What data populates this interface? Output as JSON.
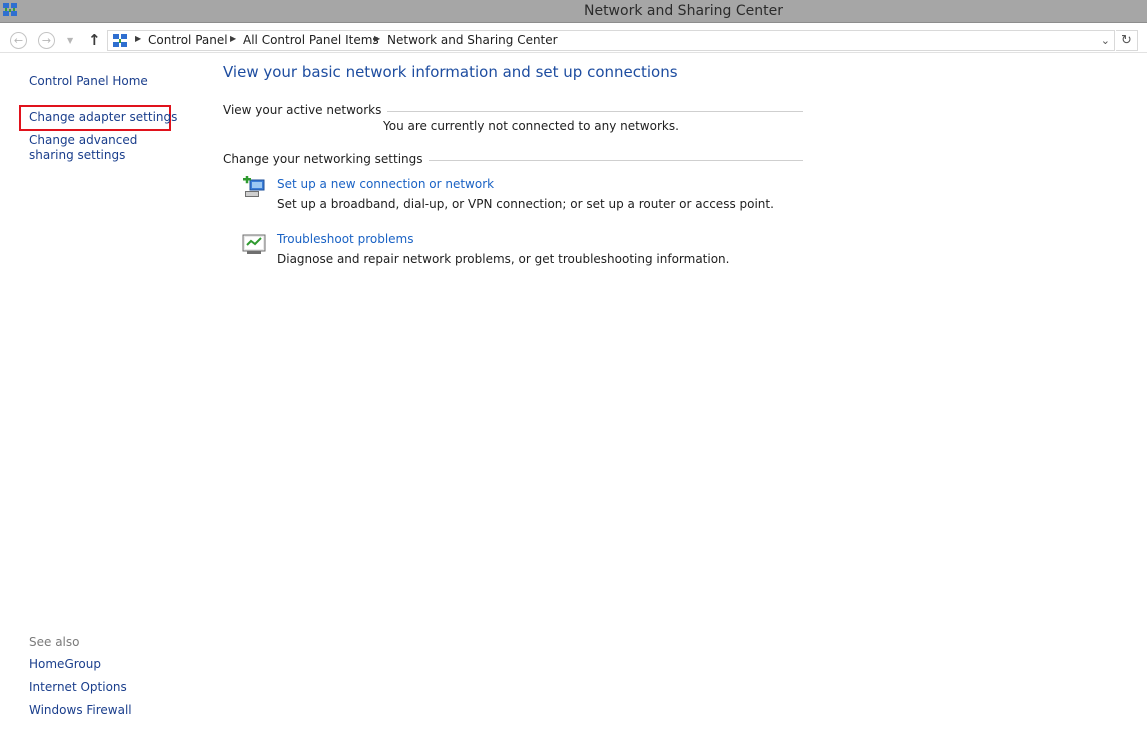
{
  "window": {
    "title": "Network and Sharing Center"
  },
  "address_bar": {
    "back_glyph": "←",
    "forward_glyph": "→",
    "up_glyph": "↑",
    "breadcrumbs": [
      "Control Panel",
      "All Control Panel Items",
      "Network and Sharing Center"
    ]
  },
  "sidebar": {
    "home": "Control Panel Home",
    "links": [
      "Change adapter settings",
      "Change advanced sharing settings"
    ],
    "see_also_title": "See also",
    "see_also": [
      "HomeGroup",
      "Internet Options",
      "Windows Firewall"
    ]
  },
  "main": {
    "heading": "View your basic network information and set up connections",
    "active_networks_label": "View your active networks",
    "not_connected": "You are currently not connected to any networks.",
    "settings_label": "Change your networking settings",
    "tasks": [
      {
        "icon": "new-connection-icon",
        "link": "Set up a new connection or network",
        "desc": "Set up a broadband, dial-up, or VPN connection; or set up a router or access point."
      },
      {
        "icon": "troubleshoot-icon",
        "link": "Troubleshoot problems",
        "desc": "Diagnose and repair network problems, or get troubleshooting information."
      }
    ]
  },
  "colors": {
    "link": "#1a3e8c",
    "task_link": "#1a62c4",
    "heading": "#1e4da0",
    "highlight": "#e0121c",
    "titlebar": "#a6a6a6"
  }
}
